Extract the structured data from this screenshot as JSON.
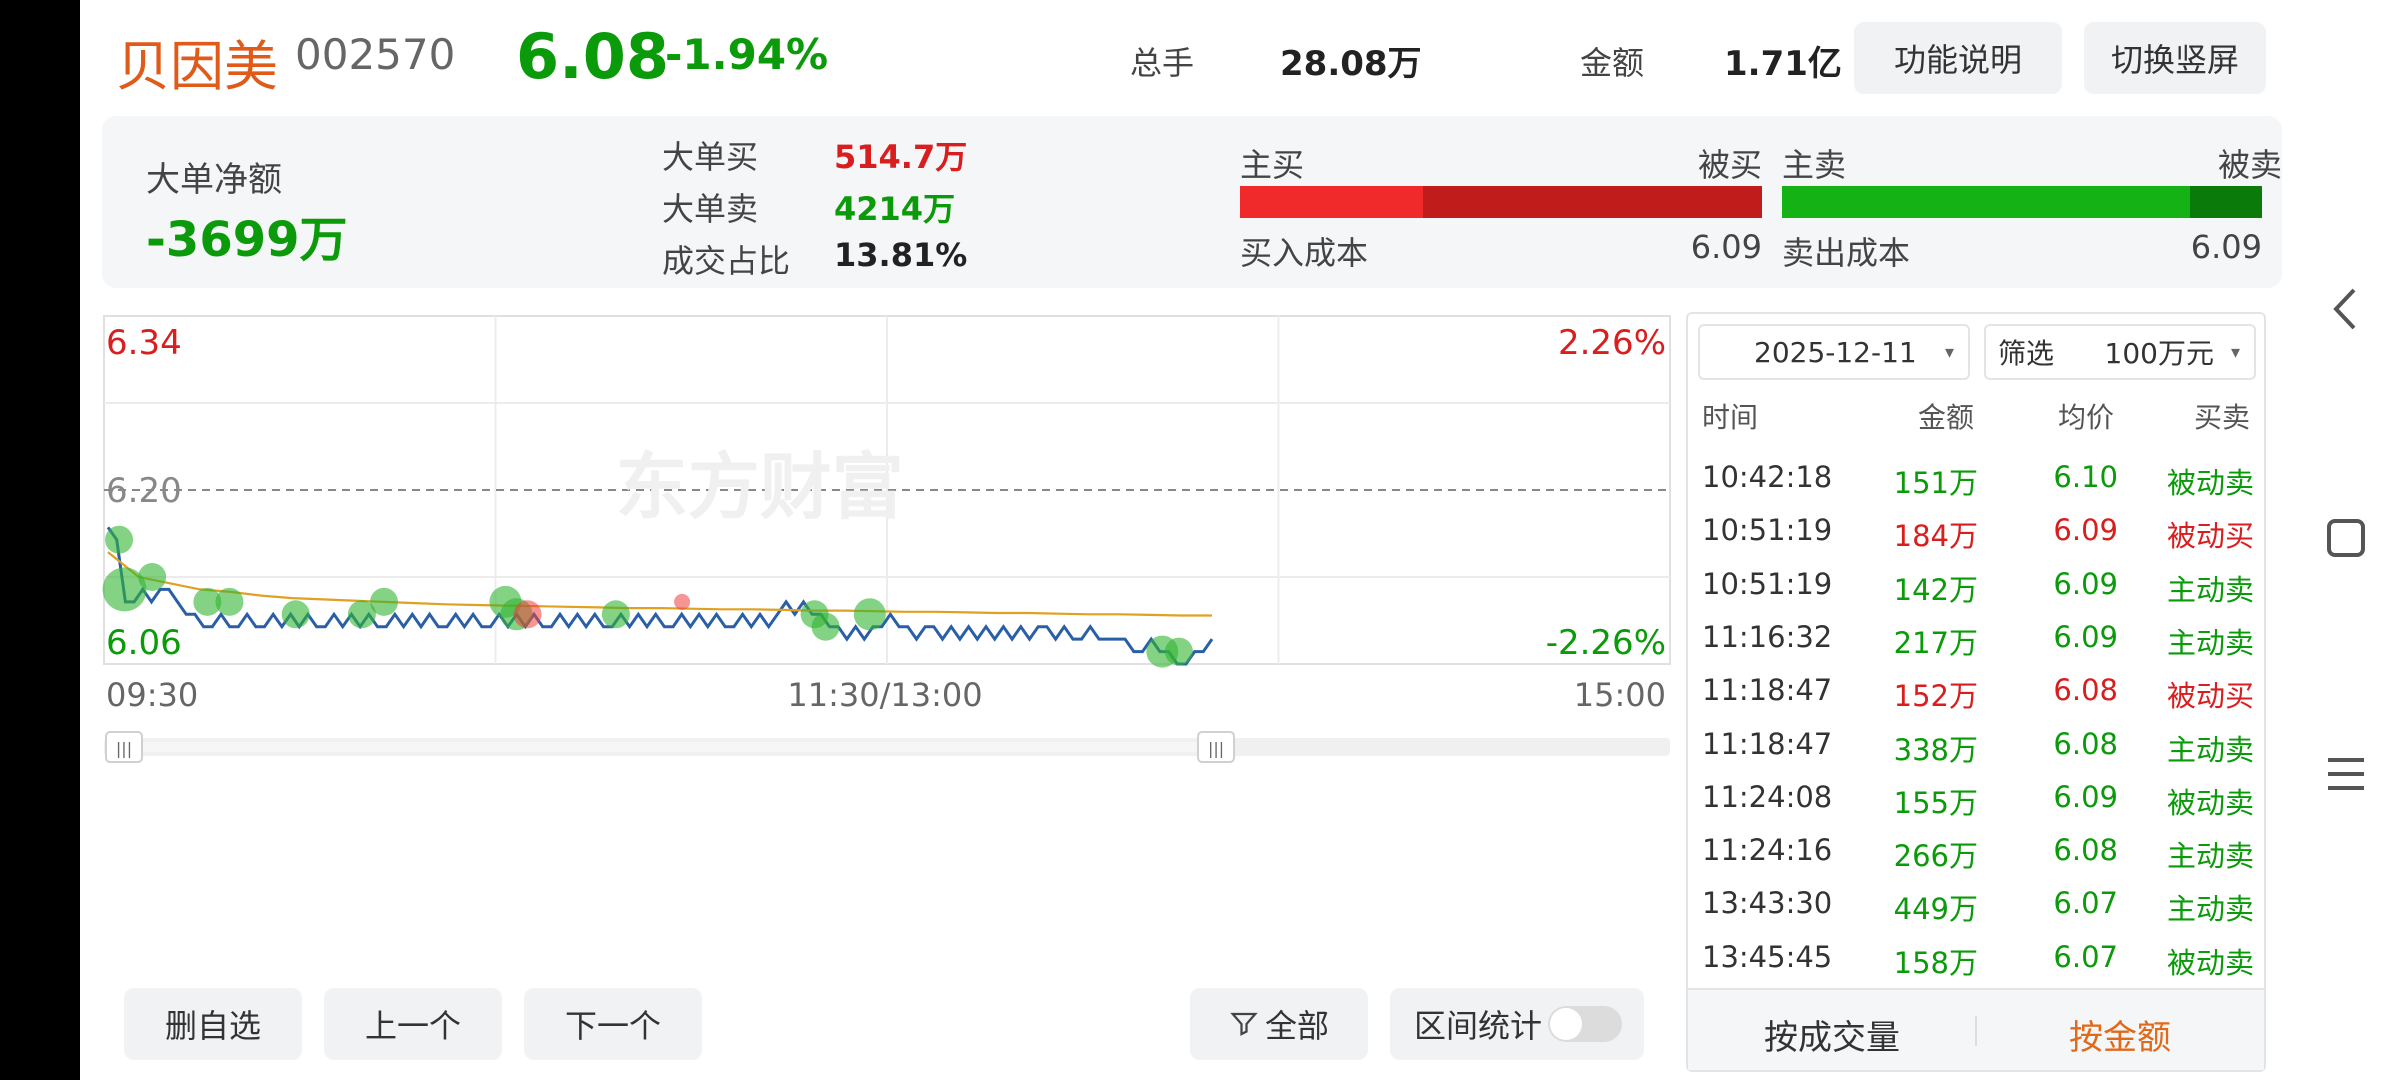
{
  "header": {
    "name": "贝因美",
    "code": "002570",
    "price": "6.08",
    "change_pct": "-1.94%",
    "volume_label": "总手",
    "volume_value": "28.08万",
    "amount_label": "金额",
    "amount_value": "1.71亿",
    "btn_help": "功能说明",
    "btn_rotate": "切换竖屏"
  },
  "summary": {
    "net_label": "大单净额",
    "net_value": "-3699万",
    "big_buy_label": "大单买",
    "big_buy_value": "514.7万",
    "big_sell_label": "大单卖",
    "big_sell_value": "4214万",
    "ratio_label": "成交占比",
    "ratio_value": "13.81%",
    "active_buy": "主买",
    "passive_buy": "被买",
    "buy_cost_label": "买入成本",
    "buy_cost_value": "6.09",
    "active_sell": "主卖",
    "passive_sell": "被卖",
    "sell_cost_label": "卖出成本",
    "sell_cost_value": "6.09",
    "buy_active_fraction": 0.35,
    "sell_active_fraction": 0.85
  },
  "chart": {
    "y_top": "6.34",
    "y_mid": "6.20",
    "y_bottom": "6.06",
    "pct_top": "2.26%",
    "pct_bottom": "-2.26%",
    "x_start": "09:30",
    "x_mid": "11:30/13:00",
    "x_end": "15:00",
    "watermark": "东方财富",
    "handle_left": "|||",
    "handle_right": "|||"
  },
  "chart_data": {
    "type": "line",
    "ylim": [
      6.06,
      6.34
    ],
    "reference": 6.2,
    "x_range": [
      "09:30",
      "15:00"
    ],
    "series": [
      {
        "values": [
          6.17,
          6.16,
          6.11,
          6.11,
          6.12,
          6.11,
          6.12,
          6.12,
          6.11,
          6.1,
          6.1,
          6.09,
          6.09,
          6.1,
          6.09,
          6.09,
          6.1,
          6.09,
          6.09,
          6.1,
          6.09,
          6.1,
          6.09,
          6.1,
          6.09,
          6.09,
          6.1,
          6.09,
          6.1,
          6.09,
          6.1,
          6.09,
          6.09,
          6.1,
          6.09,
          6.1,
          6.09,
          6.1,
          6.09,
          6.09,
          6.1,
          6.09,
          6.1,
          6.09,
          6.09,
          6.1,
          6.09,
          6.1,
          6.09,
          6.1,
          6.09,
          6.09,
          6.1,
          6.09,
          6.1,
          6.09,
          6.1,
          6.09,
          6.09,
          6.1,
          6.09,
          6.1,
          6.09,
          6.1,
          6.09,
          6.09,
          6.1,
          6.09,
          6.1,
          6.09,
          6.1,
          6.09,
          6.09,
          6.1,
          6.09,
          6.1,
          6.09,
          6.1,
          6.11,
          6.1,
          6.11,
          6.1,
          6.1,
          6.09,
          6.09,
          6.08,
          6.09,
          6.08,
          6.09,
          6.09,
          6.1,
          6.09,
          6.09,
          6.08,
          6.09,
          6.09,
          6.08,
          6.09,
          6.08,
          6.09,
          6.08,
          6.09,
          6.08,
          6.09,
          6.08,
          6.09,
          6.08,
          6.09,
          6.09,
          6.08,
          6.09,
          6.08,
          6.08,
          6.09,
          6.08,
          6.08,
          6.08,
          6.08,
          6.07,
          6.07,
          6.08,
          6.07,
          6.07,
          6.06,
          6.06,
          6.07,
          6.07,
          6.08
        ],
        "color": "#2a5fa8"
      },
      {
        "values": [
          6.15,
          6.13,
          6.125,
          6.12,
          6.118,
          6.115,
          6.113,
          6.112,
          6.111,
          6.11,
          6.109,
          6.108,
          6.1075,
          6.107,
          6.1065,
          6.106,
          6.1055,
          6.105,
          6.105,
          6.1045,
          6.104,
          6.104,
          6.1035,
          6.103,
          6.103,
          6.1025,
          6.102,
          6.102,
          6.1015,
          6.101,
          6.101,
          6.1005,
          6.1,
          6.1,
          6.0995,
          6.099,
          6.099
        ],
        "color": "#e0a020"
      }
    ],
    "markers": [
      {
        "x": 0.01,
        "y": 6.16,
        "r": 14,
        "color": "green"
      },
      {
        "x": 0.015,
        "y": 6.12,
        "r": 22,
        "color": "green"
      },
      {
        "x": 0.04,
        "y": 6.13,
        "r": 14,
        "color": "green"
      },
      {
        "x": 0.09,
        "y": 6.11,
        "r": 14,
        "color": "green"
      },
      {
        "x": 0.11,
        "y": 6.11,
        "r": 14,
        "color": "green"
      },
      {
        "x": 0.17,
        "y": 6.1,
        "r": 14,
        "color": "green"
      },
      {
        "x": 0.23,
        "y": 6.1,
        "r": 14,
        "color": "green"
      },
      {
        "x": 0.25,
        "y": 6.11,
        "r": 14,
        "color": "green"
      },
      {
        "x": 0.36,
        "y": 6.11,
        "r": 16,
        "color": "green"
      },
      {
        "x": 0.37,
        "y": 6.1,
        "r": 16,
        "color": "green"
      },
      {
        "x": 0.38,
        "y": 6.1,
        "r": 14,
        "color": "red"
      },
      {
        "x": 0.46,
        "y": 6.1,
        "r": 14,
        "color": "green"
      },
      {
        "x": 0.52,
        "y": 6.11,
        "r": 8,
        "color": "red"
      },
      {
        "x": 0.64,
        "y": 6.1,
        "r": 14,
        "color": "green"
      },
      {
        "x": 0.65,
        "y": 6.09,
        "r": 14,
        "color": "green"
      },
      {
        "x": 0.69,
        "y": 6.1,
        "r": 16,
        "color": "green"
      },
      {
        "x": 0.955,
        "y": 6.07,
        "r": 16,
        "color": "green"
      },
      {
        "x": 0.97,
        "y": 6.07,
        "r": 14,
        "color": "green"
      }
    ]
  },
  "list": {
    "date": "2025-12-11",
    "filter_label": "筛选",
    "filter_value": "100万元",
    "col_time": "时间",
    "col_amount": "金额",
    "col_avg": "均价",
    "col_side": "买卖",
    "rows": [
      {
        "time": "10:42:18",
        "amount": "151万",
        "avg": "6.10",
        "side": "被动卖",
        "color": "green"
      },
      {
        "time": "10:51:19",
        "amount": "184万",
        "avg": "6.09",
        "side": "被动买",
        "color": "red"
      },
      {
        "time": "10:51:19",
        "amount": "142万",
        "avg": "6.09",
        "side": "主动卖",
        "color": "green"
      },
      {
        "time": "11:16:32",
        "amount": "217万",
        "avg": "6.09",
        "side": "主动卖",
        "color": "green"
      },
      {
        "time": "11:18:47",
        "amount": "152万",
        "avg": "6.08",
        "side": "被动买",
        "color": "red"
      },
      {
        "time": "11:18:47",
        "amount": "338万",
        "avg": "6.08",
        "side": "主动卖",
        "color": "green"
      },
      {
        "time": "11:24:08",
        "amount": "155万",
        "avg": "6.09",
        "side": "被动卖",
        "color": "green"
      },
      {
        "time": "11:24:16",
        "amount": "266万",
        "avg": "6.08",
        "side": "主动卖",
        "color": "green"
      },
      {
        "time": "13:43:30",
        "amount": "449万",
        "avg": "6.07",
        "side": "主动卖",
        "color": "green"
      },
      {
        "time": "13:45:45",
        "amount": "158万",
        "avg": "6.07",
        "side": "被动卖",
        "color": "green"
      }
    ],
    "tab_volume": "按成交量",
    "tab_amount": "按金额"
  },
  "bottom": {
    "remove": "删自选",
    "prev": "上一个",
    "next": "下一个",
    "all": "全部",
    "range_stats": "区间统计"
  },
  "colors": {
    "up": "#d81e1e",
    "down": "#0a9a0a",
    "accent": "#e06a1a"
  }
}
